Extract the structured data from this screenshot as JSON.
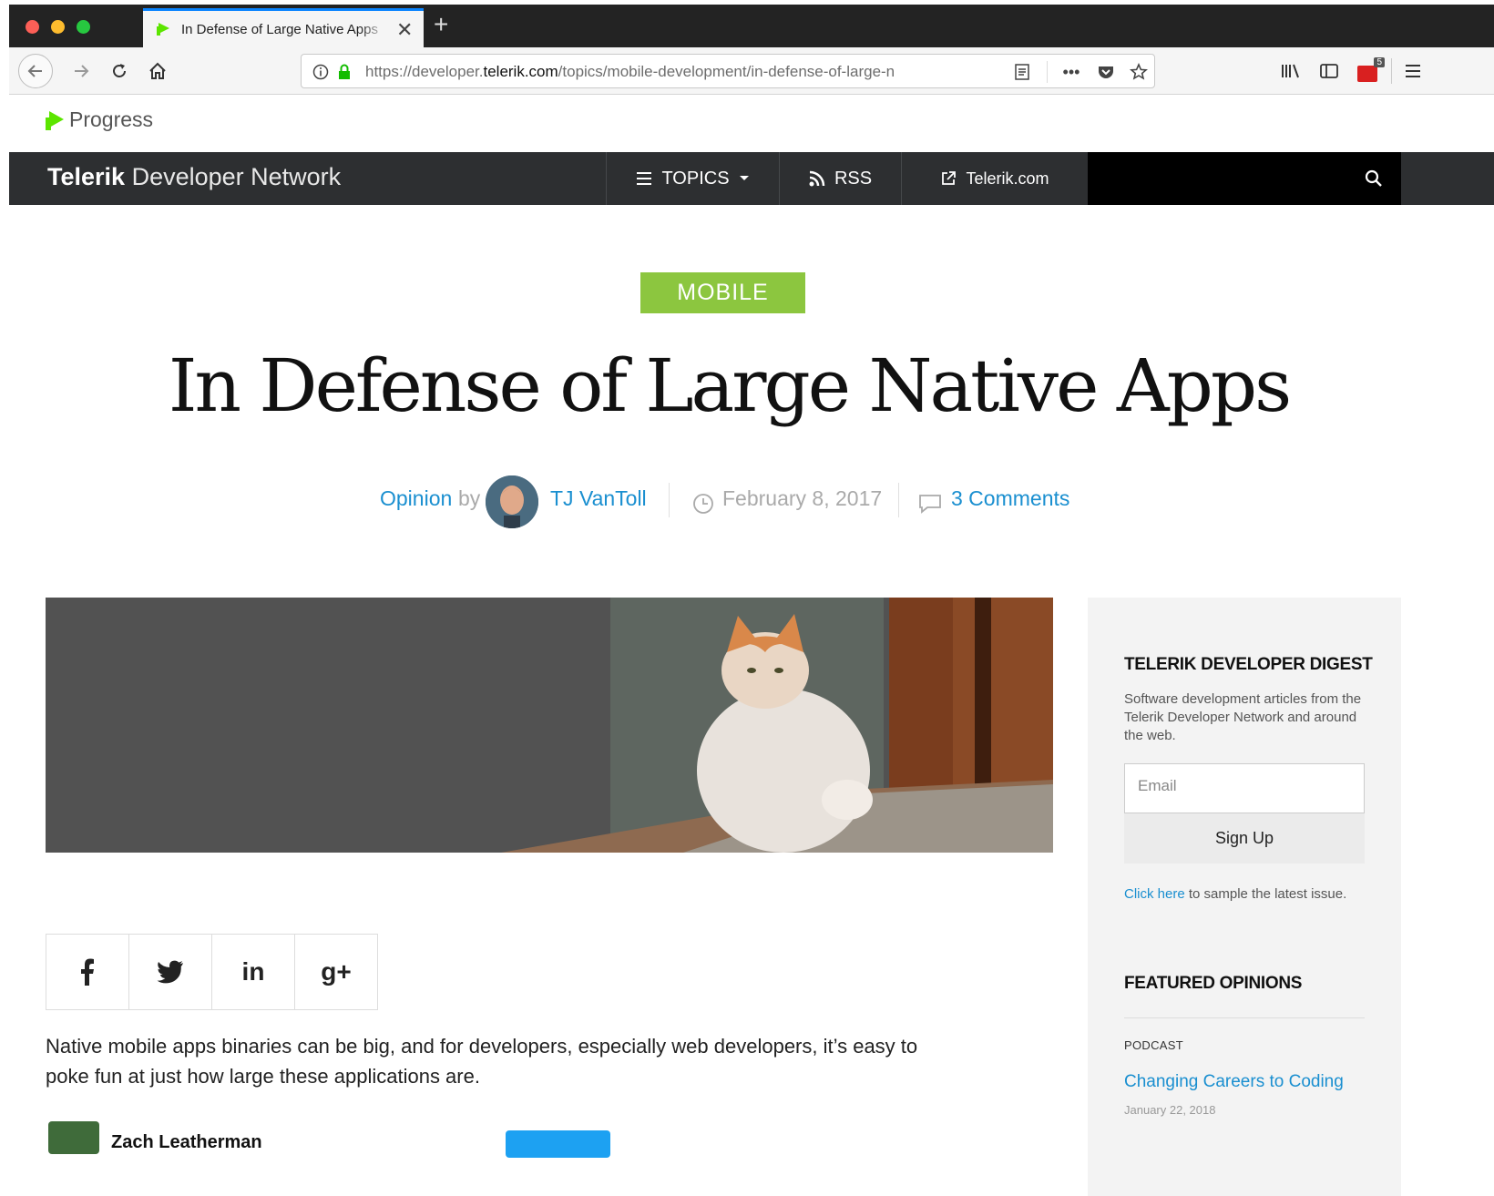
{
  "browser": {
    "tab_title": "In Defense of Large Native Apps",
    "url_prefix": "https://developer.",
    "url_host": "telerik.com",
    "url_path": "/topics/mobile-development/in-defense-of-large-n",
    "toolbar_badge": "5"
  },
  "header": {
    "progress_name": "Progress",
    "brand_bold": "Telerik",
    "brand_light": "Developer Network",
    "nav_topics": "TOPICS",
    "nav_rss": "RSS",
    "nav_telerik": "Telerik.com"
  },
  "article": {
    "category": "MOBILE",
    "title": "In Defense of Large Native Apps",
    "type": "Opinion",
    "by": "by",
    "author": "TJ VanToll",
    "date": "February 8, 2017",
    "comments": "3 Comments",
    "lede": "Native mobile apps binaries can be big, and for developers, especially web developers, it’s easy to poke fun at just how large these applications are.",
    "embed_author": "Zach Leatherman"
  },
  "share": {
    "facebook": "f",
    "twitter": "t",
    "linkedin": "in",
    "googleplus": "g+"
  },
  "sidebar": {
    "digest_title": "TELERIK DEVELOPER DIGEST",
    "digest_desc": "Software development articles from the Telerik Developer Network and around the web.",
    "email_placeholder": "Email",
    "signup_label": "Sign Up",
    "click_here": "Click here",
    "sample_text": " to sample the latest issue.",
    "featured_title": "FEATURED OPINIONS",
    "featured_category": "PODCAST",
    "featured_link": "Changing Careers to Coding",
    "featured_date": "January 22, 2018"
  },
  "colors": {
    "accent_green": "#8cc63f",
    "link_blue": "#1a8fd0",
    "nav_dark": "#2d2f31"
  }
}
